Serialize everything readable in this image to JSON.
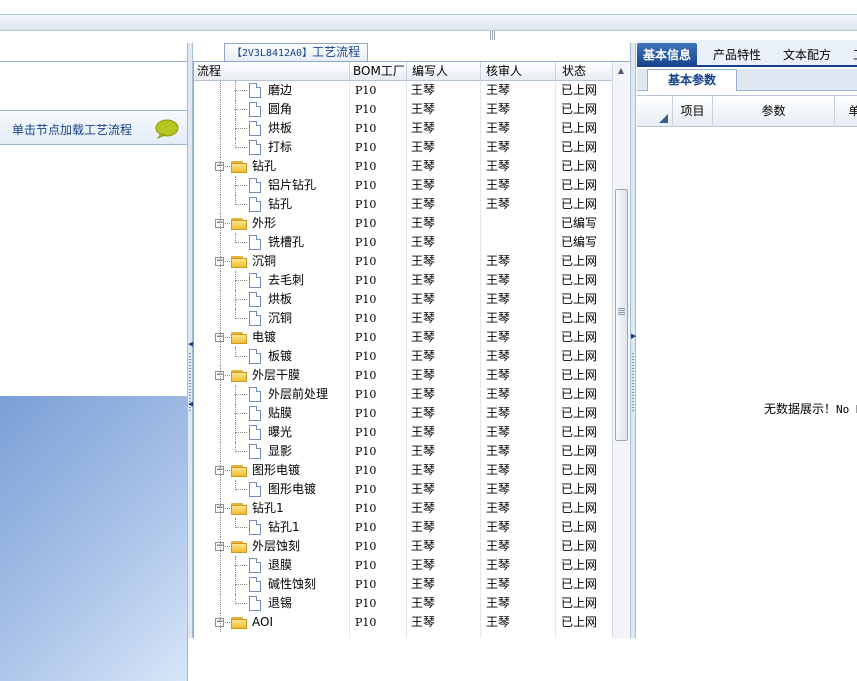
{
  "top_bar": {
    "grip": "|||"
  },
  "left_panel": {
    "load_hint": "单击节点加载工艺流程",
    "hint_icon": "speech-bubble-icon"
  },
  "center_panel": {
    "title_code": "【2V3L8412A0】",
    "title_label": "工艺流程",
    "columns": [
      "流程",
      "BOM工厂",
      "编写人",
      "核审人",
      "状态"
    ],
    "rows": [
      {
        "type": "leaf",
        "label": "磨边",
        "bom": "P10",
        "writer": "王琴",
        "reviewer": "王琴",
        "status": "已上网"
      },
      {
        "type": "leaf",
        "label": "圆角",
        "bom": "P10",
        "writer": "王琴",
        "reviewer": "王琴",
        "status": "已上网"
      },
      {
        "type": "leaf",
        "label": "烘板",
        "bom": "P10",
        "writer": "王琴",
        "reviewer": "王琴",
        "status": "已上网"
      },
      {
        "type": "leaf",
        "label": "打标",
        "bom": "P10",
        "writer": "王琴",
        "reviewer": "王琴",
        "status": "已上网"
      },
      {
        "type": "folder",
        "label": "钻孔",
        "bom": "P10",
        "writer": "王琴",
        "reviewer": "王琴",
        "status": "已上网"
      },
      {
        "type": "leaf",
        "label": "铝片钻孔",
        "bom": "P10",
        "writer": "王琴",
        "reviewer": "王琴",
        "status": "已上网"
      },
      {
        "type": "leaf",
        "label": "钻孔",
        "bom": "P10",
        "writer": "王琴",
        "reviewer": "王琴",
        "status": "已上网"
      },
      {
        "type": "folder",
        "label": "外形",
        "bom": "P10",
        "writer": "王琴",
        "reviewer": "",
        "status": "已编写"
      },
      {
        "type": "leaf",
        "label": "铣槽孔",
        "bom": "P10",
        "writer": "王琴",
        "reviewer": "",
        "status": "已编写"
      },
      {
        "type": "folder",
        "label": "沉铜",
        "bom": "P10",
        "writer": "王琴",
        "reviewer": "王琴",
        "status": "已上网"
      },
      {
        "type": "leaf",
        "label": "去毛刺",
        "bom": "P10",
        "writer": "王琴",
        "reviewer": "王琴",
        "status": "已上网"
      },
      {
        "type": "leaf",
        "label": "烘板",
        "bom": "P10",
        "writer": "王琴",
        "reviewer": "王琴",
        "status": "已上网"
      },
      {
        "type": "leaf",
        "label": "沉铜",
        "bom": "P10",
        "writer": "王琴",
        "reviewer": "王琴",
        "status": "已上网"
      },
      {
        "type": "folder",
        "label": "电镀",
        "bom": "P10",
        "writer": "王琴",
        "reviewer": "王琴",
        "status": "已上网"
      },
      {
        "type": "leaf",
        "label": "板镀",
        "bom": "P10",
        "writer": "王琴",
        "reviewer": "王琴",
        "status": "已上网"
      },
      {
        "type": "folder",
        "label": "外层干膜",
        "bom": "P10",
        "writer": "王琴",
        "reviewer": "王琴",
        "status": "已上网"
      },
      {
        "type": "leaf",
        "label": "外层前处理",
        "bom": "P10",
        "writer": "王琴",
        "reviewer": "王琴",
        "status": "已上网"
      },
      {
        "type": "leaf",
        "label": "贴膜",
        "bom": "P10",
        "writer": "王琴",
        "reviewer": "王琴",
        "status": "已上网"
      },
      {
        "type": "leaf",
        "label": "曝光",
        "bom": "P10",
        "writer": "王琴",
        "reviewer": "王琴",
        "status": "已上网"
      },
      {
        "type": "leaf",
        "label": "显影",
        "bom": "P10",
        "writer": "王琴",
        "reviewer": "王琴",
        "status": "已上网"
      },
      {
        "type": "folder",
        "label": "图形电镀",
        "bom": "P10",
        "writer": "王琴",
        "reviewer": "王琴",
        "status": "已上网"
      },
      {
        "type": "leaf",
        "label": "图形电镀",
        "bom": "P10",
        "writer": "王琴",
        "reviewer": "王琴",
        "status": "已上网"
      },
      {
        "type": "folder",
        "label": "钻孔1",
        "bom": "P10",
        "writer": "王琴",
        "reviewer": "王琴",
        "status": "已上网"
      },
      {
        "type": "leaf",
        "label": "钻孔1",
        "bom": "P10",
        "writer": "王琴",
        "reviewer": "王琴",
        "status": "已上网"
      },
      {
        "type": "folder",
        "label": "外层蚀刻",
        "bom": "P10",
        "writer": "王琴",
        "reviewer": "王琴",
        "status": "已上网"
      },
      {
        "type": "leaf",
        "label": "退膜",
        "bom": "P10",
        "writer": "王琴",
        "reviewer": "王琴",
        "status": "已上网"
      },
      {
        "type": "leaf",
        "label": "碱性蚀刻",
        "bom": "P10",
        "writer": "王琴",
        "reviewer": "王琴",
        "status": "已上网"
      },
      {
        "type": "leaf",
        "label": "退锡",
        "bom": "P10",
        "writer": "王琴",
        "reviewer": "王琴",
        "status": "已上网"
      },
      {
        "type": "folder",
        "label": "AOI",
        "bom": "P10",
        "writer": "王琴",
        "reviewer": "王琴",
        "status": "已上网"
      }
    ]
  },
  "right_panel": {
    "tabs": [
      "基本信息",
      "产品特性",
      "文本配方",
      "工"
    ],
    "active_tab": "基本信息",
    "subtab": "基本参数",
    "columns": [
      "项目",
      "参数",
      "单"
    ],
    "empty_text": "无数据展示！",
    "empty_text_en": "No D"
  }
}
